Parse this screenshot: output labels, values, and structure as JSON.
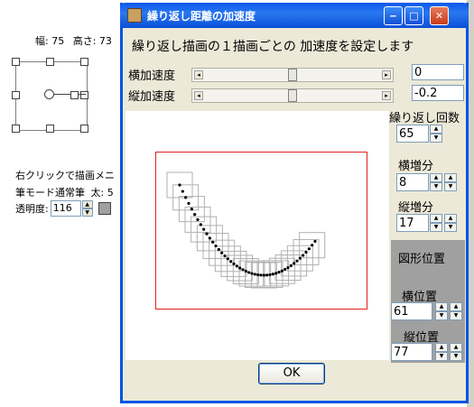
{
  "background": {
    "width_label": "幅: 75",
    "height_label": "高さ: 73",
    "hint": "右クリックで描画メニ",
    "pen_mode": "筆モード通常筆",
    "thickness": "太: 5",
    "opacity_label": "透明度:",
    "opacity_value": "116"
  },
  "dialog": {
    "title": "繰り返し距離の加速度",
    "heading": "繰り返し描画の１描画ごとの 加速度を設定します",
    "h_accel_label": "横加速度",
    "h_accel_value": "0",
    "h_accel_level": 0.5,
    "v_accel_label": "縦加速度",
    "v_accel_value": "-0.2",
    "v_accel_level": 0.5,
    "repeat_label": "繰り返し回数",
    "repeat_value": "65",
    "h_inc_label": "横増分",
    "h_inc_value": "8",
    "v_inc_label": "縦増分",
    "v_inc_value": "17",
    "shape_pos_label": "図形位置",
    "h_pos_label": "横位置",
    "h_pos_value": "61",
    "v_pos_label": "縦位置",
    "v_pos_value": "77",
    "ok_label": "OK"
  },
  "colors": {
    "title_bar": "#0a58e9",
    "frame": "#e02020",
    "stroke": "#000000",
    "trail": "#b0b0b0",
    "group": "#a0a0a0"
  }
}
